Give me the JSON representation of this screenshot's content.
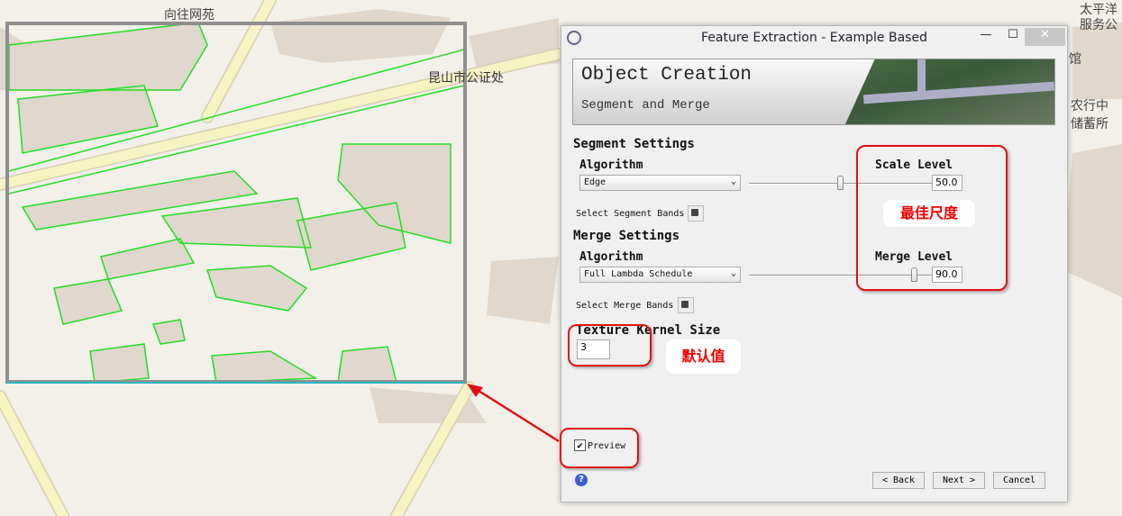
{
  "map": {
    "labels": [
      "向往网苑",
      "昆山市公证处",
      "太平洋",
      "服务公",
      "馆",
      "农行中",
      "储蓄所"
    ],
    "preview_labels": [
      "昆山市公证处"
    ],
    "colors": {
      "background": "#f3f0ea",
      "building": "#e0d8cc",
      "road": "#f7f4c4",
      "segment_outline": "#22dd22"
    }
  },
  "dialog": {
    "title": "Feature Extraction - Example Based",
    "controls": {
      "minimize": "—",
      "maximize": "☐",
      "close": "✕"
    },
    "banner": {
      "title": "Object Creation",
      "subtitle": "Segment and Merge"
    },
    "segment": {
      "heading": "Segment Settings",
      "algorithm_label": "Algorithm",
      "algorithm_value": "Edge",
      "level_label": "Scale Level",
      "level_value": "50.0",
      "slider_percent": 50,
      "bands_label": "Select Segment Bands"
    },
    "merge": {
      "heading": "Merge Settings",
      "algorithm_label": "Algorithm",
      "algorithm_value": "Full Lambda Schedule",
      "level_label": "Merge Level",
      "level_value": "90.0",
      "slider_percent": 90,
      "bands_label": "Select Merge Bands"
    },
    "texture": {
      "label": "Texture Kernel Size",
      "value": "3"
    },
    "preview": {
      "label": "Preview",
      "checked": true
    },
    "buttons": {
      "back": "< Back",
      "next": "Next >",
      "cancel": "Cancel",
      "help": "?"
    }
  },
  "annotations": {
    "best_scale": "最佳尺度",
    "default_value": "默认值",
    "color": "#e01010"
  }
}
